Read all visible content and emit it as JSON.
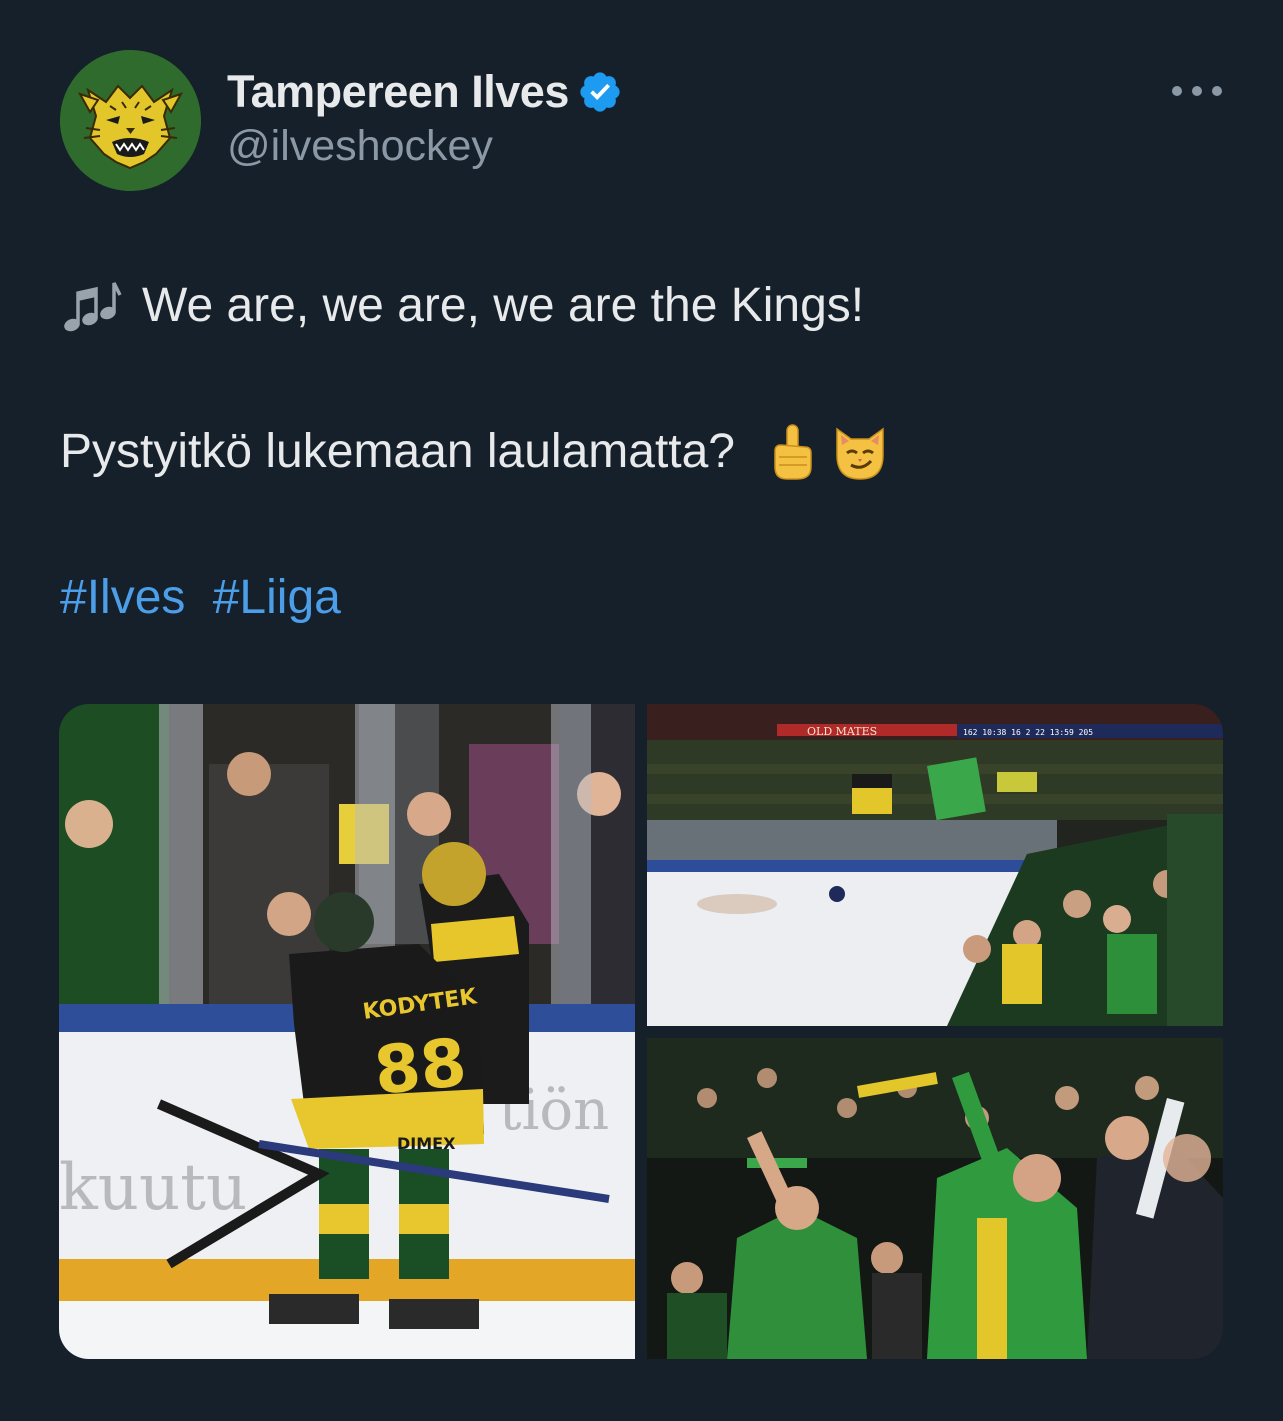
{
  "account": {
    "display_name": "Tampereen Ilves",
    "handle": "@ilveshockey",
    "verified": true
  },
  "tweet": {
    "line1_emoji": "music-notes",
    "line1_text": "We are, we are, we are the Kings!",
    "line2_text": "Pystyitkö lukemaan laulamatta?",
    "line2_emojis": [
      "pointing-up",
      "smirking-cat"
    ],
    "hashtags": [
      "#Ilves",
      "#Liiga"
    ]
  },
  "media": {
    "photo1": {
      "jersey_name": "KODYTEK",
      "jersey_number": "88",
      "board_text": "kuutu",
      "board_text2": "tiön",
      "sponsor": "DIMEX"
    },
    "photo2": {
      "banner_text": "OLD MATES",
      "scoreboard": "162 10:38 16 2 22 13:59 205"
    }
  },
  "colors": {
    "background": "#15202b",
    "hashtag": "#1d9bf0",
    "verified": "#1d9bf0",
    "ilves_green": "#1f6b2a",
    "ilves_yellow": "#f2c01e"
  }
}
